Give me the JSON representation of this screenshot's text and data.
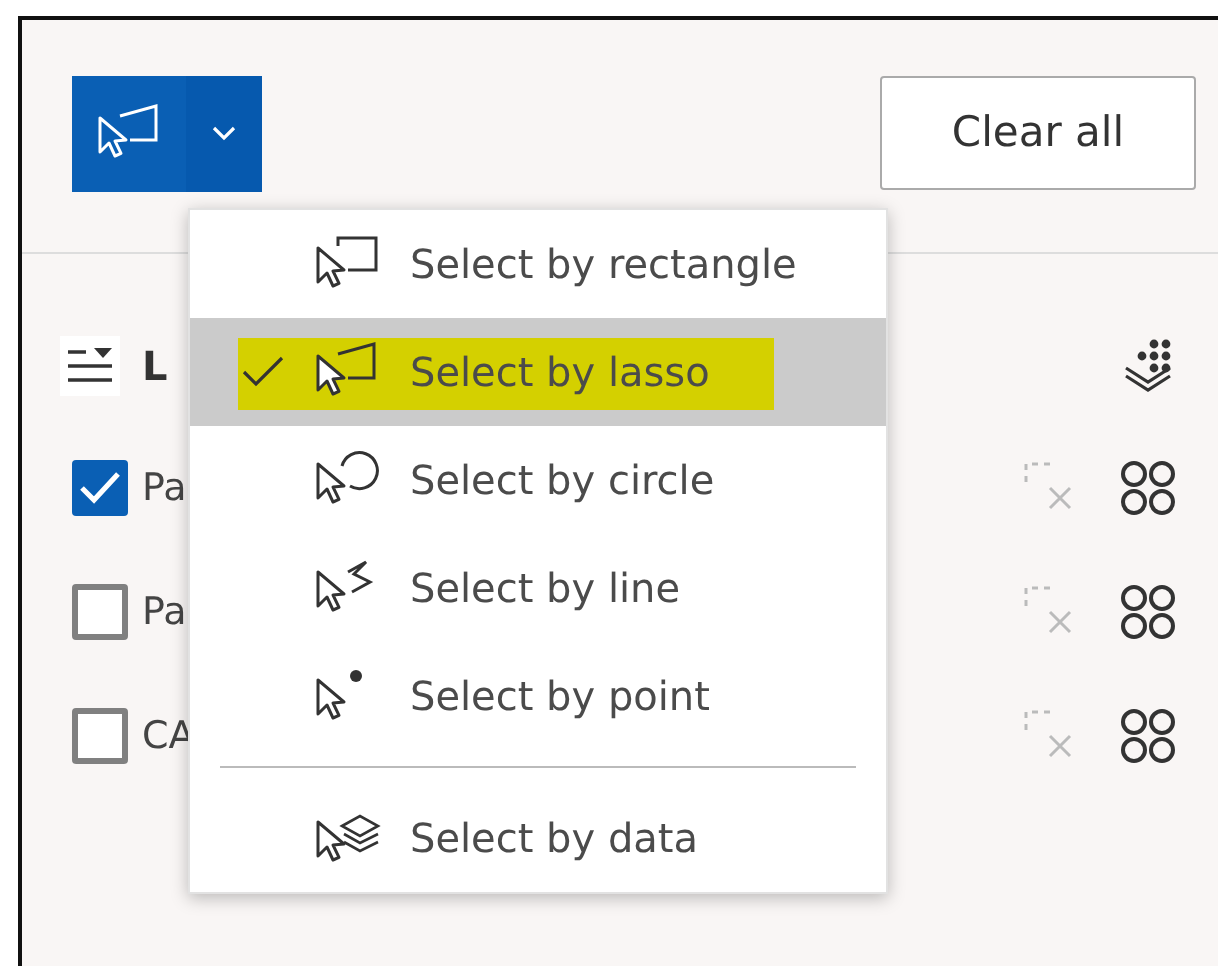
{
  "select_tool": {
    "menu_open": true
  },
  "clear_button": "Clear all",
  "layers_header": {
    "title": "L"
  },
  "layers": [
    {
      "name": "Pa",
      "checked": true
    },
    {
      "name": "Pa",
      "checked": false
    },
    {
      "name": "CA",
      "checked": false
    }
  ],
  "menu": {
    "groups": [
      [
        {
          "label": "Select by rectangle",
          "kind": "rectangle",
          "selected": false
        },
        {
          "label": "Select by lasso",
          "kind": "lasso",
          "selected": true
        },
        {
          "label": "Select by circle",
          "kind": "circle",
          "selected": false
        },
        {
          "label": "Select by line",
          "kind": "line",
          "selected": false
        },
        {
          "label": "Select by point",
          "kind": "point",
          "selected": false
        }
      ],
      [
        {
          "label": "Select by data",
          "kind": "data",
          "selected": false
        }
      ]
    ]
  }
}
